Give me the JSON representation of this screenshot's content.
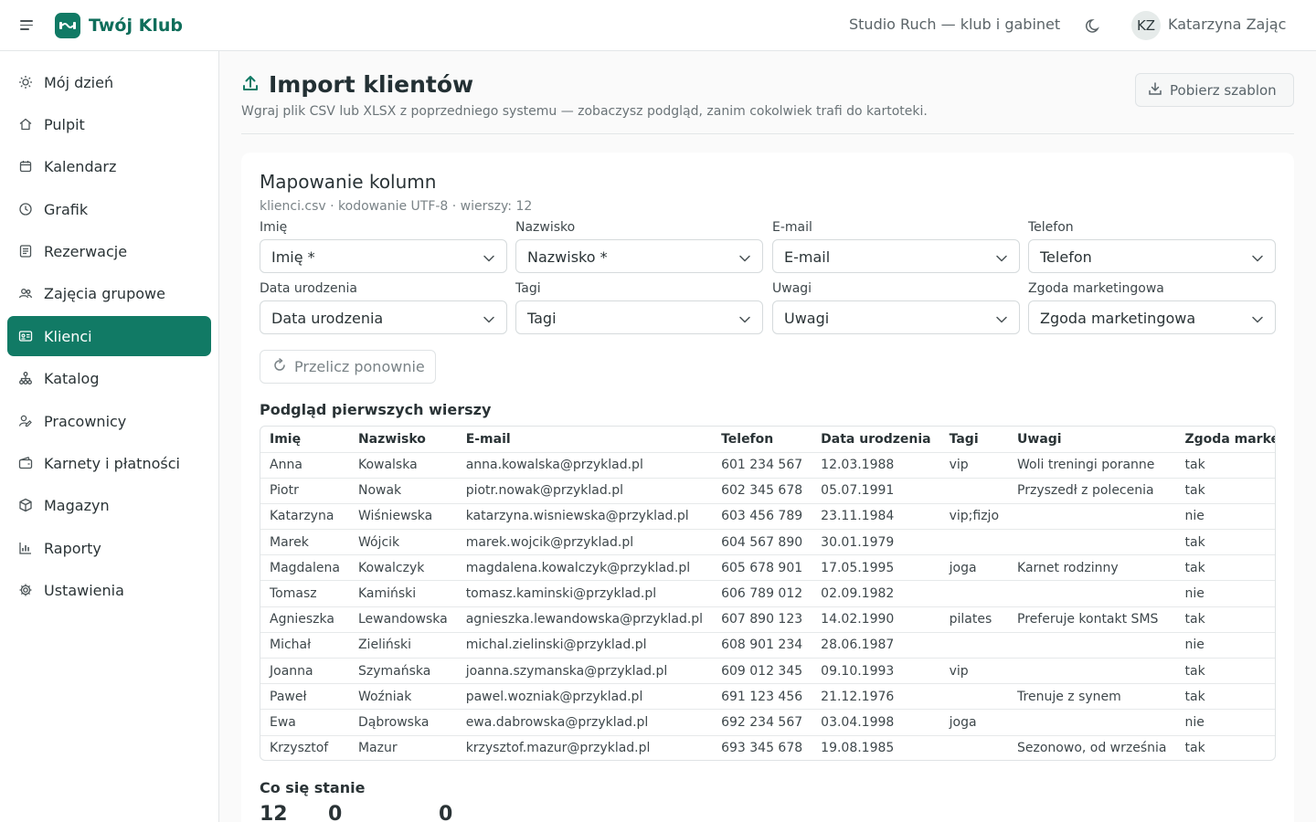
{
  "app": {
    "name": "Twój Klub",
    "studio": "Studio Ruch — klub i gabinet"
  },
  "user": {
    "initials": "KZ",
    "name": "Katarzyna Zając"
  },
  "sidebar": {
    "items": [
      {
        "label": "Mój dzień",
        "icon": "sun-icon"
      },
      {
        "label": "Pulpit",
        "icon": "home-icon"
      },
      {
        "label": "Kalendarz",
        "icon": "calendar-icon"
      },
      {
        "label": "Grafik",
        "icon": "clock-icon"
      },
      {
        "label": "Rezerwacje",
        "icon": "list-icon"
      },
      {
        "label": "Zajęcia grupowe",
        "icon": "group-icon"
      },
      {
        "label": "Klienci",
        "icon": "id-card-icon",
        "active": true
      },
      {
        "label": "Katalog",
        "icon": "hierarchy-icon"
      },
      {
        "label": "Pracownicy",
        "icon": "user-edit-icon"
      },
      {
        "label": "Karnety i płatności",
        "icon": "wallet-icon"
      },
      {
        "label": "Magazyn",
        "icon": "box-icon"
      },
      {
        "label": "Raporty",
        "icon": "bar-chart-icon"
      },
      {
        "label": "Ustawienia",
        "icon": "gear-icon"
      }
    ]
  },
  "page": {
    "title": "Import klientów",
    "subtitle": "Wgraj plik CSV lub XLSX z poprzedniego systemu — zobaczysz podgląd, zanim cokolwiek trafi do kartoteki.",
    "template_button": "Pobierz szablon"
  },
  "mapping": {
    "title": "Mapowanie kolumn",
    "meta": "klienci.csv · kodowanie UTF-8 · wierszy: 12",
    "fields": [
      {
        "label": "Imię",
        "value": "Imię *"
      },
      {
        "label": "Nazwisko",
        "value": "Nazwisko *"
      },
      {
        "label": "E-mail",
        "value": "E-mail"
      },
      {
        "label": "Telefon",
        "value": "Telefon"
      },
      {
        "label": "Data urodzenia",
        "value": "Data urodzenia"
      },
      {
        "label": "Tagi",
        "value": "Tagi"
      },
      {
        "label": "Uwagi",
        "value": "Uwagi"
      },
      {
        "label": "Zgoda marketingowa",
        "value": "Zgoda marketingowa"
      }
    ],
    "recalc_button": "Przelicz ponownie"
  },
  "preview": {
    "title": "Podgląd pierwszych wierszy",
    "columns": [
      "Imię",
      "Nazwisko",
      "E-mail",
      "Telefon",
      "Data urodzenia",
      "Tagi",
      "Uwagi",
      "Zgoda marketingowa"
    ],
    "rows": [
      [
        "Anna",
        "Kowalska",
        "anna.kowalska@przyklad.pl",
        "601 234 567",
        "12.03.1988",
        "vip",
        "Woli treningi poranne",
        "tak"
      ],
      [
        "Piotr",
        "Nowak",
        "piotr.nowak@przyklad.pl",
        "602 345 678",
        "05.07.1991",
        "",
        "Przyszedł z polecenia",
        "tak"
      ],
      [
        "Katarzyna",
        "Wiśniewska",
        "katarzyna.wisniewska@przyklad.pl",
        "603 456 789",
        "23.11.1984",
        "vip;fizjo",
        "",
        "nie"
      ],
      [
        "Marek",
        "Wójcik",
        "marek.wojcik@przyklad.pl",
        "604 567 890",
        "30.01.1979",
        "",
        "",
        "tak"
      ],
      [
        "Magdalena",
        "Kowalczyk",
        "magdalena.kowalczyk@przyklad.pl",
        "605 678 901",
        "17.05.1995",
        "joga",
        "Karnet rodzinny",
        "tak"
      ],
      [
        "Tomasz",
        "Kamiński",
        "tomasz.kaminski@przyklad.pl",
        "606 789 012",
        "02.09.1982",
        "",
        "",
        "nie"
      ],
      [
        "Agnieszka",
        "Lewandowska",
        "agnieszka.lewandowska@przyklad.pl",
        "607 890 123",
        "14.02.1990",
        "pilates",
        "Preferuje kontakt SMS",
        "tak"
      ],
      [
        "Michał",
        "Zieliński",
        "michal.zielinski@przyklad.pl",
        "608 901 234",
        "28.06.1987",
        "",
        "",
        "nie"
      ],
      [
        "Joanna",
        "Szymańska",
        "joanna.szymanska@przyklad.pl",
        "609 012 345",
        "09.10.1993",
        "vip",
        "",
        "tak"
      ],
      [
        "Paweł",
        "Woźniak",
        "pawel.wozniak@przyklad.pl",
        "691 123 456",
        "21.12.1976",
        "",
        "Trenuje z synem",
        "tak"
      ],
      [
        "Ewa",
        "Dąbrowska",
        "ewa.dabrowska@przyklad.pl",
        "692 234 567",
        "03.04.1998",
        "joga",
        "",
        "nie"
      ],
      [
        "Krzysztof",
        "Mazur",
        "krzysztof.mazur@przyklad.pl",
        "693 345 678",
        "19.08.1985",
        "",
        "Sezonowo, od września",
        "tak"
      ]
    ]
  },
  "outcome": {
    "title": "Co się stanie",
    "numbers": [
      "12",
      "0",
      "0"
    ]
  },
  "colors": {
    "accent": "#117a65",
    "brand_text": "#0f6e5b"
  }
}
